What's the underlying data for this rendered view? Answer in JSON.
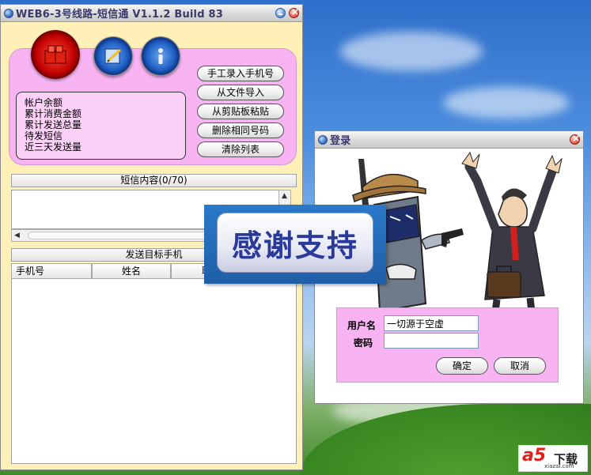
{
  "main_window": {
    "title": "WEB6-3号线路-短信通  V1.1.2 Build 83",
    "stats": [
      "帐户余额",
      "累计消费金额",
      "累计发送总量",
      "待发短信",
      "近三天发送量"
    ],
    "buttons": [
      "手工录入手机号",
      "从文件导入",
      "从剪贴板粘贴",
      "删除相同号码",
      "清除列表"
    ],
    "sms_header": "短信内容(0/70)",
    "target_header": "发送目标手机",
    "columns": [
      "手机号",
      "姓名",
      "职"
    ]
  },
  "banner": {
    "text": "感谢支持"
  },
  "login": {
    "title": "登录",
    "username_label": "用户名",
    "username_value": "一切源于空虚",
    "password_label": "密码",
    "password_value": "",
    "ok_label": "确定",
    "cancel_label": "取消"
  },
  "watermark": {
    "logo": "a5",
    "label": "下载",
    "url": "xiazai.com"
  },
  "colors": {
    "panel_pink": "#f7b3f2",
    "window_cream": "#fff0b8",
    "banner_blue": "#1f5ea7"
  }
}
